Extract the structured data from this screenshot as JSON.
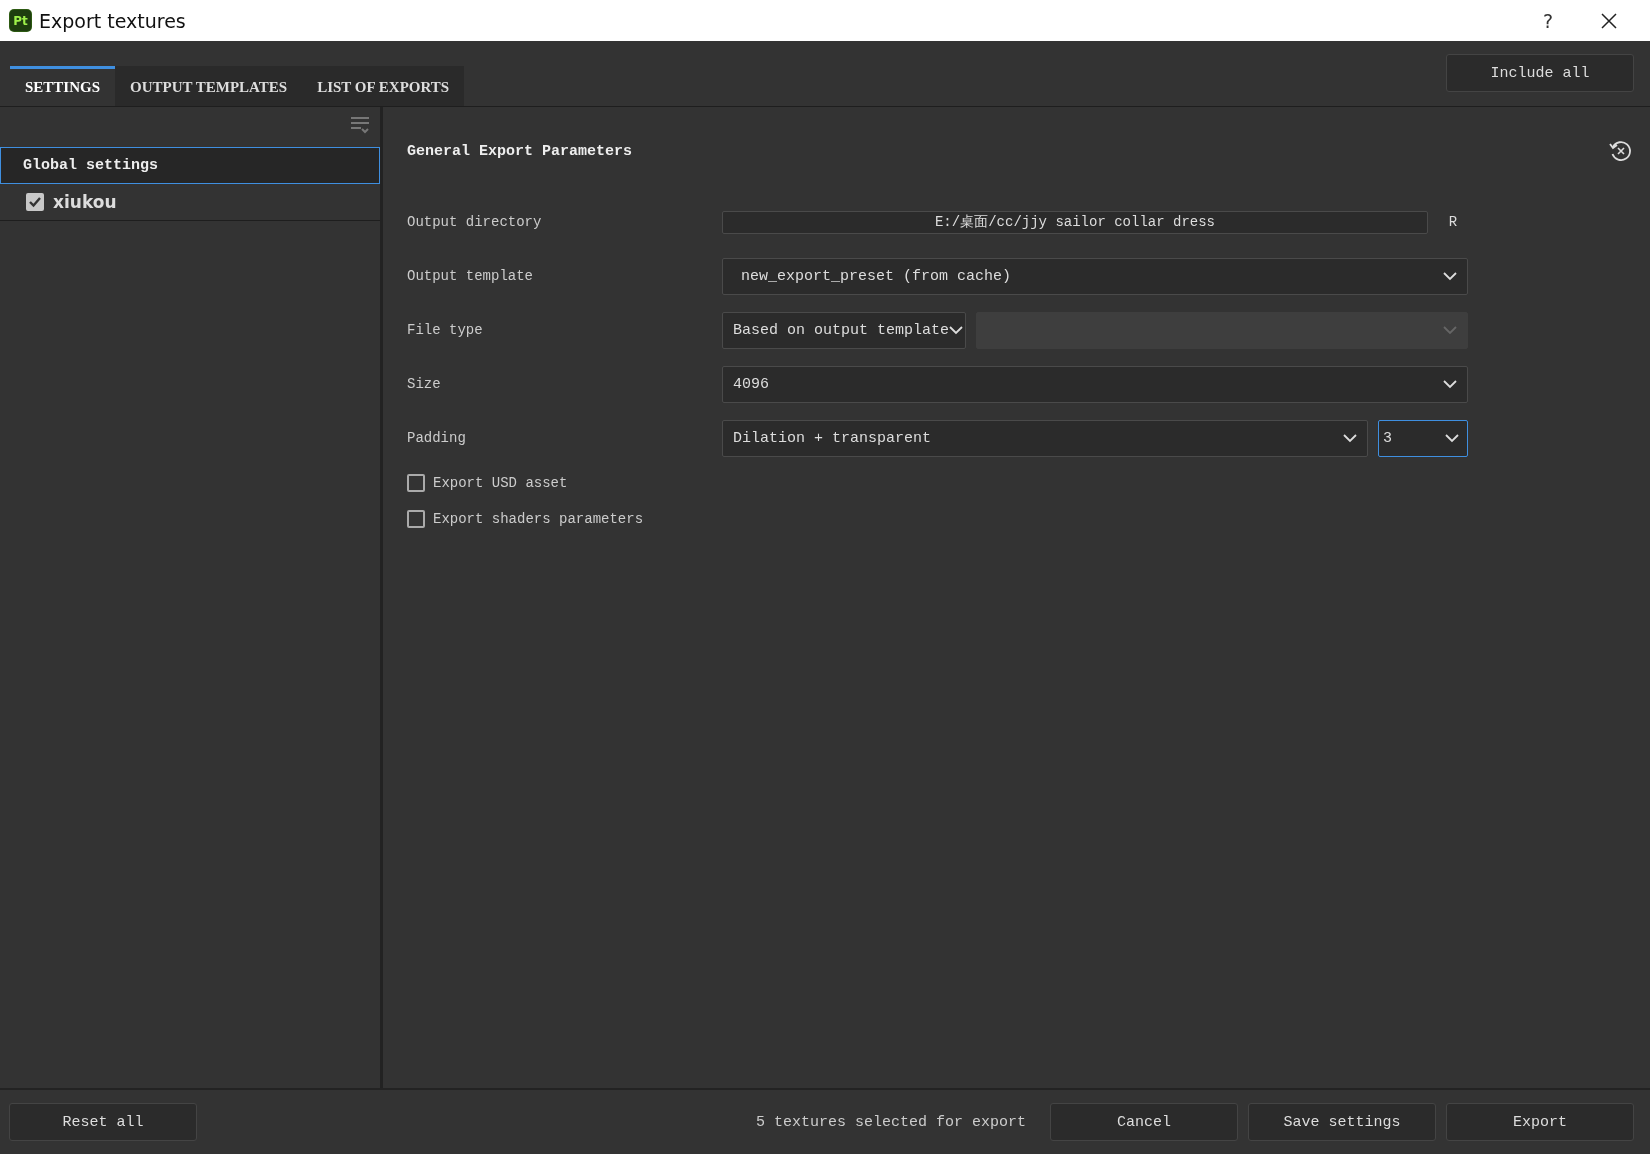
{
  "window": {
    "title": "Export textures",
    "app_icon": "Pt",
    "help": "?"
  },
  "tabs": [
    {
      "label": "SETTINGS",
      "selected": true
    },
    {
      "label": "OUTPUT TEMPLATES",
      "selected": false
    },
    {
      "label": "LIST OF EXPORTS",
      "selected": false
    }
  ],
  "include_all_button": "Include all",
  "sidebar": {
    "items": [
      {
        "label": "Global settings",
        "kind": "header",
        "selected": true
      },
      {
        "label": "xiukou",
        "kind": "check",
        "checked": true,
        "selected": false
      }
    ]
  },
  "section_title": "General Export Parameters",
  "fields": [
    {
      "label": "Output directory",
      "kind": "path",
      "value": "E:/桌面/cc/jjy sailor collar dress",
      "suffix": "R"
    },
    {
      "label": "Output template",
      "kind": "select",
      "value": "new_export_preset (from cache)"
    },
    {
      "label": "File type",
      "kind": "split",
      "value": "Based on output template",
      "secondary": {
        "disabled": true
      }
    },
    {
      "label": "Size",
      "kind": "select",
      "value": "4096"
    },
    {
      "label": "Padding",
      "kind": "padding",
      "value": "Dilation + transparent",
      "secondary": {
        "value": "3",
        "focused": true
      }
    }
  ],
  "options": [
    {
      "label": "Export USD asset",
      "checked": false
    },
    {
      "label": "Export shaders parameters",
      "checked": false
    }
  ],
  "footer": {
    "reset_button": "Reset all",
    "status": "5 textures selected for export",
    "buttons": [
      "Cancel",
      "Save settings",
      "Export"
    ]
  }
}
